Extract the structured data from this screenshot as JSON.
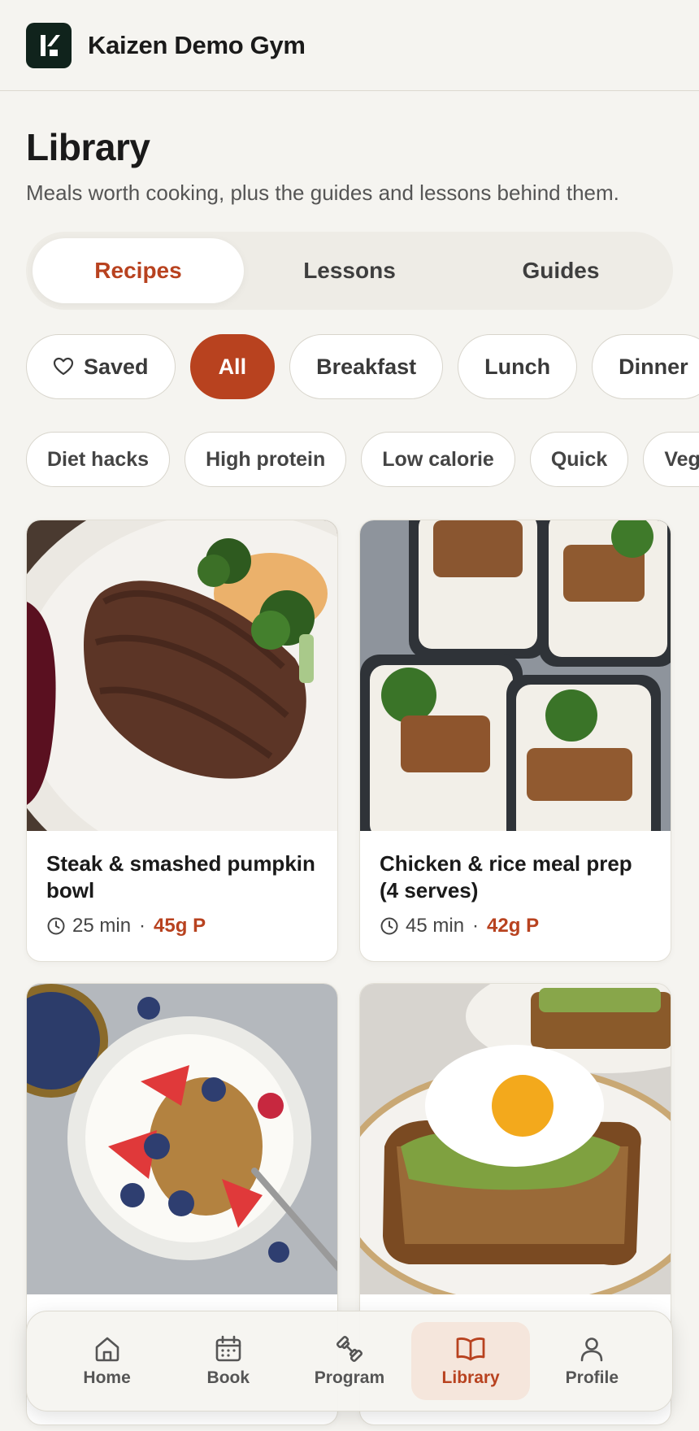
{
  "header": {
    "gym_name": "Kaizen Demo Gym"
  },
  "page": {
    "title": "Library",
    "subtitle": "Meals worth cooking, plus the guides and lessons behind them."
  },
  "tabs": [
    {
      "label": "Recipes",
      "active": true
    },
    {
      "label": "Lessons",
      "active": false
    },
    {
      "label": "Guides",
      "active": false
    }
  ],
  "meal_filters": [
    {
      "label": "Saved",
      "icon": "heart-icon"
    },
    {
      "label": "All",
      "active": true
    },
    {
      "label": "Breakfast"
    },
    {
      "label": "Lunch"
    },
    {
      "label": "Dinner"
    }
  ],
  "tag_filters": [
    "Diet hacks",
    "High protein",
    "Low calorie",
    "Quick",
    "Vegetarian"
  ],
  "recipes": [
    {
      "title": "Steak & smashed pumpkin bowl",
      "time": "25 min",
      "protein": "45g P"
    },
    {
      "title": "Chicken & rice meal prep (4 serves)",
      "time": "45 min",
      "protein": "42g P"
    },
    {
      "title": "",
      "time": "",
      "protein": ""
    },
    {
      "title": "",
      "time": "",
      "protein": ""
    }
  ],
  "bottom_nav": [
    {
      "label": "Home",
      "icon": "home-icon"
    },
    {
      "label": "Book",
      "icon": "calendar-icon"
    },
    {
      "label": "Program",
      "icon": "dumbbell-icon"
    },
    {
      "label": "Library",
      "icon": "book-open-icon",
      "active": true
    },
    {
      "label": "Profile",
      "icon": "user-icon"
    }
  ],
  "colors": {
    "accent": "#b8421f",
    "background": "#f5f4f0",
    "logo_bg": "#10231c"
  }
}
